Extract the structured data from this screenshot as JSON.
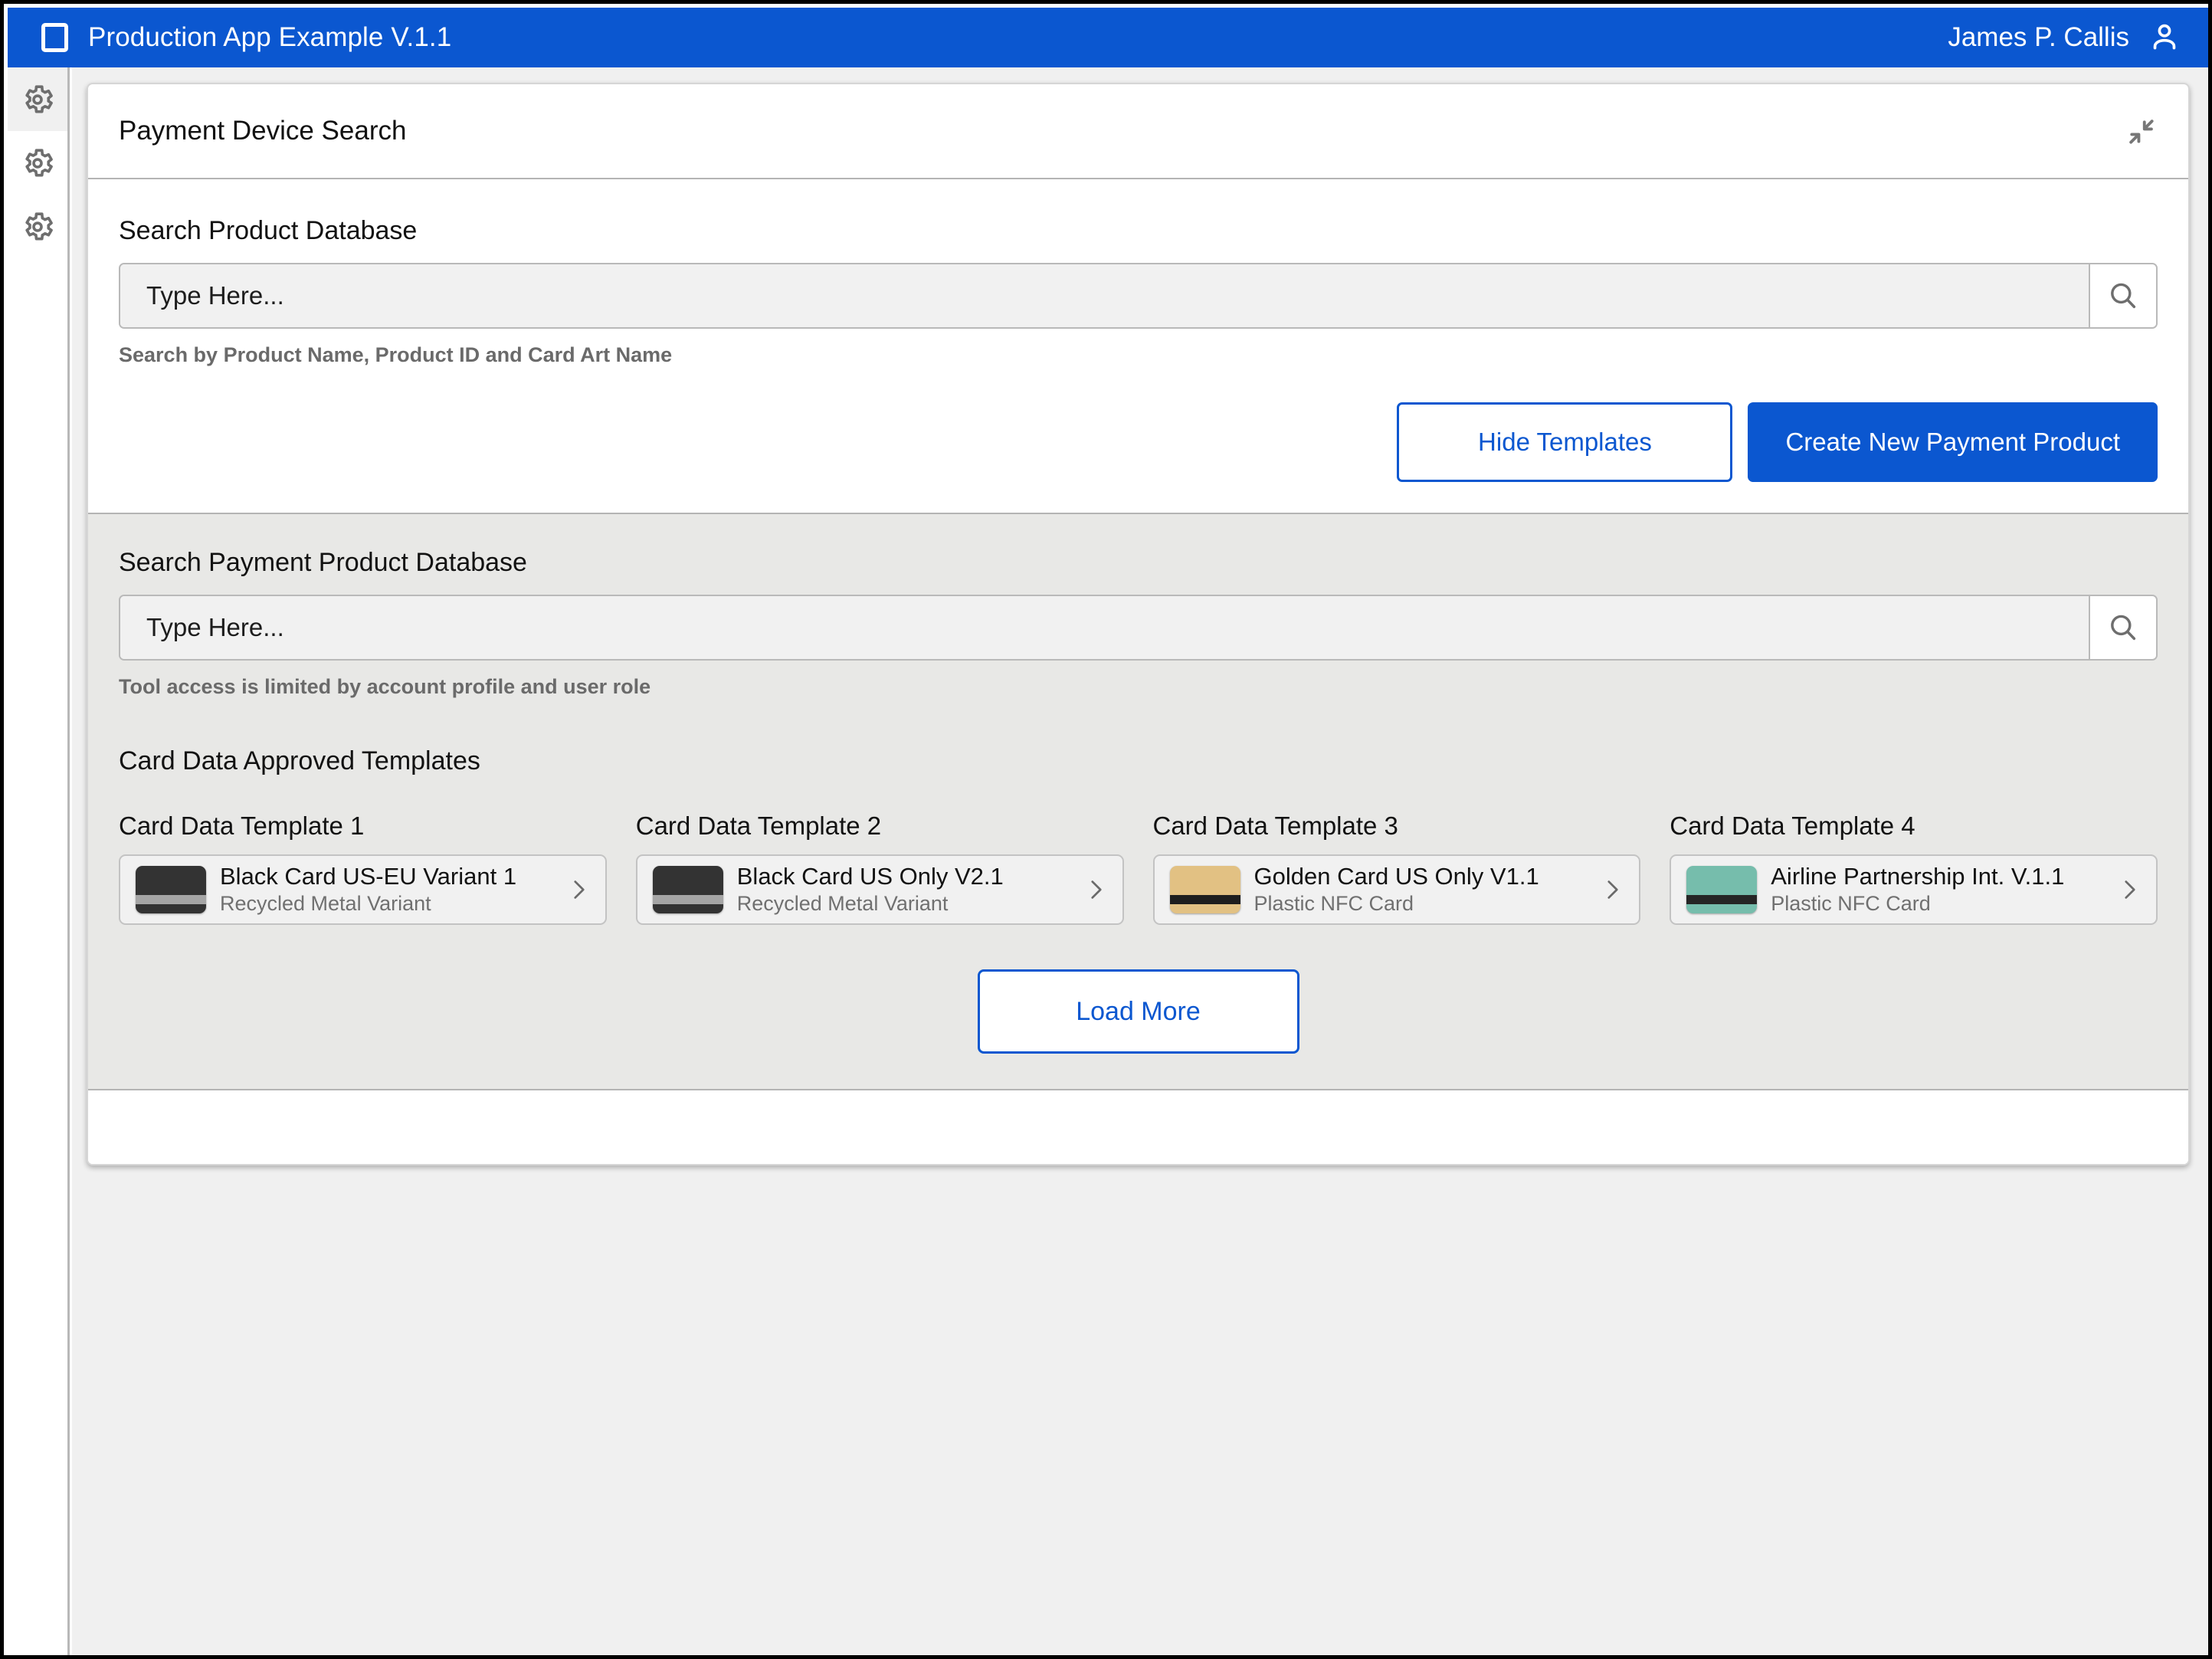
{
  "topbar": {
    "app_icon": "square-outline-icon",
    "title": "Production App Example V.1.1",
    "user_name": "James P. Callis",
    "user_icon": "person-icon",
    "background_color": "#0b57d0"
  },
  "sidebar": {
    "items": [
      {
        "icon": "gear-icon",
        "name": "settings-1",
        "active": true
      },
      {
        "icon": "gear-icon",
        "name": "settings-2",
        "active": false
      },
      {
        "icon": "gear-icon",
        "name": "settings-3",
        "active": false
      }
    ]
  },
  "card": {
    "header": {
      "title": "Payment Device Search",
      "collapse_icon": "collapse-arrows-icon"
    },
    "product_search": {
      "label": "Search Product Database",
      "placeholder": "Type Here...",
      "value": "",
      "search_icon": "search-icon",
      "helper": "Search by Product Name, Product ID and Card Art Name"
    },
    "actions": {
      "hide_templates": "Hide Templates",
      "create_new": "Create New Payment Product",
      "accent_color": "#0b57d0"
    },
    "payment_search": {
      "label": "Search Payment Product Database",
      "placeholder": "Type Here...",
      "value": "",
      "search_icon": "search-icon",
      "helper": "Tool access is limited by account profile and user role"
    },
    "templates": {
      "section_title": "Card Data Approved Templates",
      "items": [
        {
          "column_label": "Card Data Template 1",
          "name": "Black Card US-EU Variant 1",
          "subtitle": "Recycled Metal Variant",
          "thumb_color": "#333333",
          "stripe_color": "#a5a5a5",
          "chevron": "chevron-right-icon"
        },
        {
          "column_label": "Card Data Template 2",
          "name": "Black Card US Only V2.1",
          "subtitle": "Recycled Metal Variant",
          "thumb_color": "#333333",
          "stripe_color": "#a5a5a5",
          "chevron": "chevron-right-icon"
        },
        {
          "column_label": "Card Data Template 3",
          "name": "Golden Card US Only V1.1",
          "subtitle": "Plastic NFC Card",
          "thumb_color": "#e2c183",
          "stripe_color": "#1e1e1e",
          "chevron": "chevron-right-icon"
        },
        {
          "column_label": "Card Data Template 4",
          "name": "Airline Partnership Int. V.1.1",
          "subtitle": "Plastic NFC Card",
          "thumb_color": "#76bdac",
          "stripe_color": "#252525",
          "chevron": "chevron-right-icon"
        }
      ],
      "load_more": "Load More"
    }
  }
}
